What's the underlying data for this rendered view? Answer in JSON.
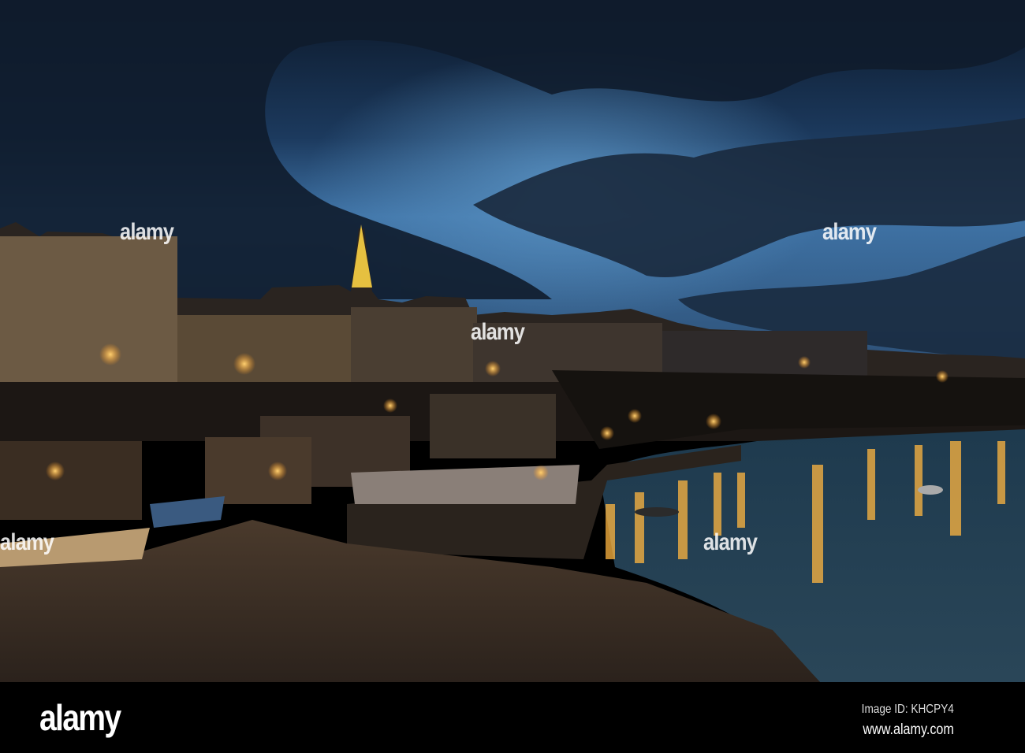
{
  "photo": {
    "subject": "Harbour town at dusk with lit houses, church spire, beach and water reflections",
    "colors": {
      "sky_top": "#0d1a2c",
      "sky_glow": "#4a7fb0",
      "sand": "#3b2f26",
      "water": "#1b3446",
      "light": "#ffb640"
    }
  },
  "watermark": {
    "text": "alamy"
  },
  "footer": {
    "logo": "alamy",
    "image_id": "Image ID: KHCPY4",
    "website": "www.alamy.com"
  }
}
